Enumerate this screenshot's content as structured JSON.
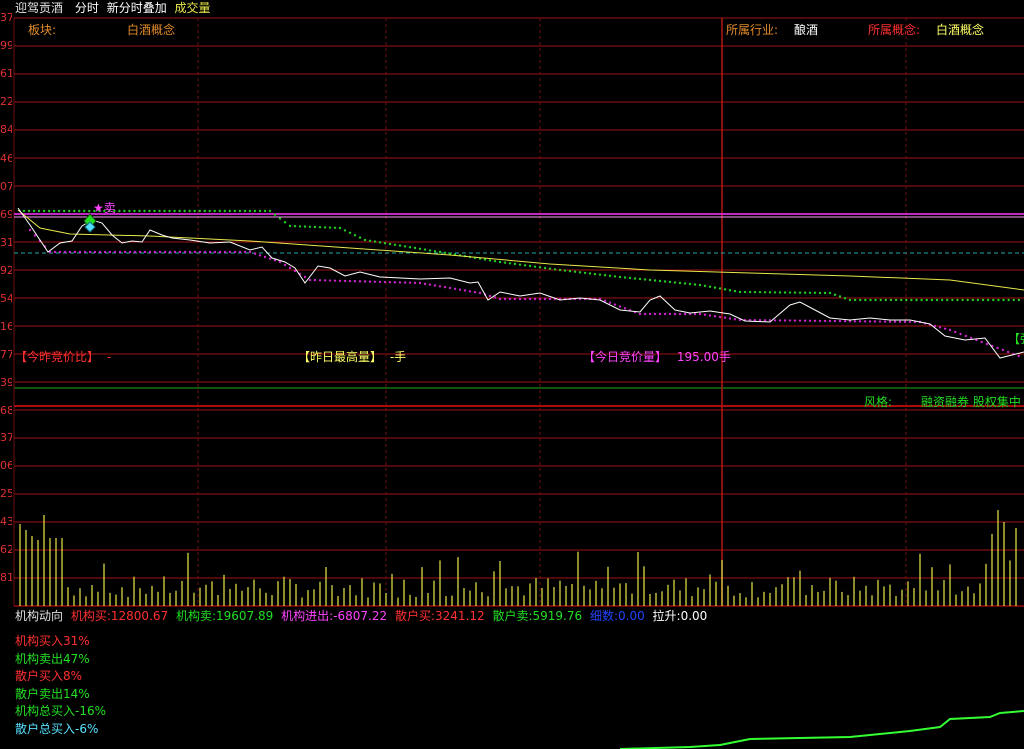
{
  "header": {
    "stock_name": "迎驾贡酒",
    "mode_intraday": "分时",
    "mode_overlay": "新分时叠加",
    "mode_volume": "成交量"
  },
  "info_bar": {
    "sector_label": "板块:",
    "sector_value": "白酒概念",
    "industry_label": "所属行业:",
    "industry_value": "酿酒",
    "concept_label": "所属概念:",
    "concept_value": "白酒概念"
  },
  "annotations": {
    "sell_marker": "★卖",
    "right_edge_tag": "【强"
  },
  "auction": {
    "ratio_label": "【今昨竞价比】",
    "ratio_value": "-",
    "yday_high_label": "【昨日最高量】",
    "yday_high_value": "-手",
    "today_volume_label": "【今日竞价量】",
    "today_volume_value": "195.00手"
  },
  "style_bar": {
    "label": "风格:",
    "value": "融资融券 股权集中 现"
  },
  "price_axis": [
    "37",
    "99",
    "61",
    "22",
    "84",
    "46",
    "07",
    "69",
    "31",
    "92",
    "54",
    "16",
    "77",
    "39",
    "68"
  ],
  "volume_axis": [
    "37",
    "06",
    "25",
    "43",
    "62",
    "81"
  ],
  "flow": {
    "title": "机构动向",
    "inst_buy_label": "机构买:",
    "inst_buy_value": "12800.67",
    "inst_sell_label": "机构卖:",
    "inst_sell_value": "19607.89",
    "inst_net_label": "机构进出:",
    "inst_net_value": "-6807.22",
    "retail_buy_label": "散户买:",
    "retail_buy_value": "3241.12",
    "retail_sell_label": "散户卖:",
    "retail_sell_value": "5919.76",
    "hidden_label": "细数:",
    "hidden_value": "0.00",
    "pull_label": "拉升:",
    "pull_value": "0.00"
  },
  "ratios": [
    {
      "label": "机构买入31%",
      "color": "#ff3030"
    },
    {
      "label": "机构卖出47%",
      "color": "#22e022"
    },
    {
      "label": "散户买入8%",
      "color": "#ff3030"
    },
    {
      "label": "散户卖出14%",
      "color": "#22e022"
    },
    {
      "label": "机构总买入-16%",
      "color": "#22e022"
    },
    {
      "label": "散户总买入-6%",
      "color": "#55e0ff"
    }
  ],
  "colors": {
    "grid": "#a01010",
    "price_line": "#ffffff",
    "avg_line": "#e8e84a",
    "up_dots": "#22cc22",
    "down_dots": "#cc22cc",
    "volume_bars": "#e8e84a",
    "label_orange": "#e08a2a",
    "label_red": "#ff3030",
    "label_magenta": "#ff44ff",
    "label_yellow": "#ffff66",
    "label_green": "#22dd22"
  }
}
